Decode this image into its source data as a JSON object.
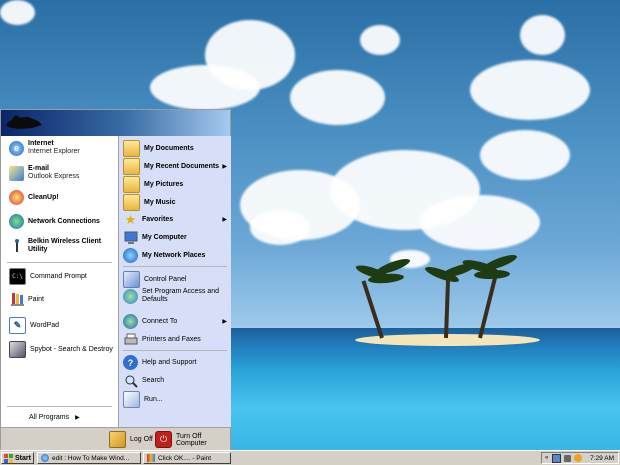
{
  "start_menu": {
    "left_items": [
      {
        "title": "Internet",
        "subtitle": "Internet Explorer",
        "icon": "internet-explorer-icon"
      },
      {
        "title": "E-mail",
        "subtitle": "Outlook Express",
        "icon": "outlook-express-icon"
      },
      {
        "title": "CleanUp!",
        "icon": "cleanup-icon"
      },
      {
        "title": "Network Connections",
        "icon": "network-connections-icon"
      },
      {
        "title": "Belkin Wireless Client Utility",
        "icon": "wireless-utility-icon"
      },
      {
        "title": "Command Prompt",
        "icon": "command-prompt-icon"
      },
      {
        "title": "Paint",
        "icon": "paint-icon"
      },
      {
        "title": "WordPad",
        "icon": "wordpad-icon"
      },
      {
        "title": "Spybot - Search & Destroy",
        "icon": "spybot-icon"
      }
    ],
    "all_programs": "All Programs",
    "right_items": [
      {
        "label": "My Documents",
        "icon": "folder-icon",
        "bold": true
      },
      {
        "label": "My Recent Documents",
        "icon": "folder-icon",
        "bold": true,
        "submenu": true
      },
      {
        "label": "My Pictures",
        "icon": "folder-icon",
        "bold": true
      },
      {
        "label": "My Music",
        "icon": "folder-icon",
        "bold": true
      },
      {
        "label": "Favorites",
        "icon": "star-icon",
        "bold": true,
        "submenu": true
      },
      {
        "label": "My Computer",
        "icon": "computer-icon",
        "bold": true
      },
      {
        "label": "My Network Places",
        "icon": "network-places-icon",
        "bold": true
      },
      {
        "label": "Control Panel",
        "icon": "control-panel-icon"
      },
      {
        "label": "Set Program Access and Defaults",
        "icon": "program-access-icon"
      },
      {
        "label": "Connect To",
        "icon": "connect-to-icon",
        "submenu": true
      },
      {
        "label": "Printers and Faxes",
        "icon": "printer-icon"
      },
      {
        "label": "Help and Support",
        "icon": "help-icon"
      },
      {
        "label": "Search",
        "icon": "search-icon"
      },
      {
        "label": "Run...",
        "icon": "run-icon"
      }
    ],
    "log_off": "Log Off",
    "turn_off": "Turn Off Computer"
  },
  "taskbar": {
    "start": "Start",
    "tasks": [
      {
        "label": "edit : How To Make Wind...",
        "icon": "browser-icon"
      },
      {
        "label": "Click OK.... - Paint",
        "icon": "paint-icon"
      }
    ],
    "clock": "7:29 AM"
  },
  "colors": {
    "menu_header": "#0a246a",
    "right_pane": "#d6dff7",
    "taskbar": "#d4d0c8"
  }
}
